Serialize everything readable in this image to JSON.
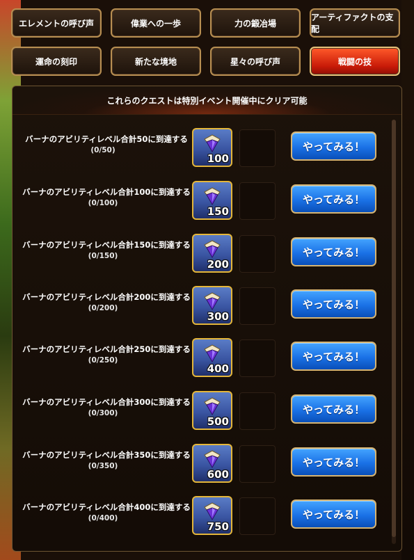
{
  "tabs": [
    {
      "label": "エレメントの呼び声",
      "active": false
    },
    {
      "label": "偉業への一歩",
      "active": false
    },
    {
      "label": "力の鍛冶場",
      "active": false
    },
    {
      "label": "アーティファクトの支配",
      "active": false
    },
    {
      "label": "運命の刻印",
      "active": false
    },
    {
      "label": "新たな境地",
      "active": false
    },
    {
      "label": "星々の呼び声",
      "active": false
    },
    {
      "label": "戦闘の技",
      "active": true
    }
  ],
  "panel": {
    "header": "これらのクエストは特別イベント開催中にクリア可能"
  },
  "quests": [
    {
      "title": "バーナのアビリティレベル合計50に到達する",
      "progress": "(0/50)",
      "reward": "100",
      "button": "やってみる！"
    },
    {
      "title": "バーナのアビリティレベル合計100に到達する",
      "progress": "(0/100)",
      "reward": "150",
      "button": "やってみる！"
    },
    {
      "title": "バーナのアビリティレベル合計150に到達する",
      "progress": "(0/150)",
      "reward": "200",
      "button": "やってみる！"
    },
    {
      "title": "バーナのアビリティレベル合計200に到達する",
      "progress": "(0/200)",
      "reward": "300",
      "button": "やってみる！"
    },
    {
      "title": "バーナのアビリティレベル合計250に到達する",
      "progress": "(0/250)",
      "reward": "400",
      "button": "やってみる！"
    },
    {
      "title": "バーナのアビリティレベル合計300に到達する",
      "progress": "(0/300)",
      "reward": "500",
      "button": "やってみる！"
    },
    {
      "title": "バーナのアビリティレベル合計350に到達する",
      "progress": "(0/350)",
      "reward": "600",
      "button": "やってみる！"
    },
    {
      "title": "バーナのアビリティレベル合計400に到達する",
      "progress": "(0/400)",
      "reward": "750",
      "button": "やってみる！"
    }
  ],
  "icons": {
    "reward": "crystal-gem-icon"
  },
  "colors": {
    "active_tab": "#d42a10",
    "button": "#1a71e6",
    "frame_gold": "#b88f52"
  }
}
